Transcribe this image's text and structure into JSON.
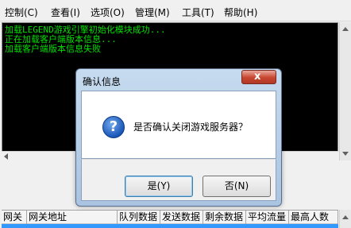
{
  "menu": [
    {
      "label": "控制(C)"
    },
    {
      "label": "查看(I)"
    },
    {
      "label": "选项(O)"
    },
    {
      "label": "管理(M)"
    },
    {
      "label": "工具(T)"
    },
    {
      "label": "帮助(H)"
    }
  ],
  "console": {
    "lines": [
      "加载LEGEND游戏引擎初始化模块成功...",
      "正在加载客户端版本信息...",
      "加载客户端版本信息失败"
    ]
  },
  "table": {
    "columns": [
      "网关",
      "网关地址",
      "队列数据",
      "发送数据",
      "剩余数据",
      "平均流量",
      "最高人数"
    ]
  },
  "dialog": {
    "title": "确认信息",
    "close_glyph": "x",
    "icon": "question-icon",
    "icon_glyph": "?",
    "message": "是否确认关闭游戏服务器？",
    "yes_label": "是(Y)",
    "no_label": "否(N)"
  },
  "colors": {
    "console_bg": "#000000",
    "console_text": "#00e000",
    "selection": "#3399ff"
  }
}
